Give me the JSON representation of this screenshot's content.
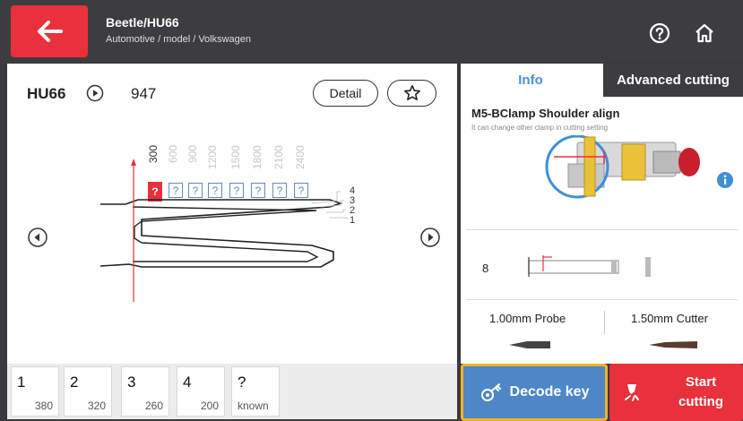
{
  "header": {
    "title": "Beetle/HU66",
    "breadcrumb": "Automotive / model / Volkswagen",
    "help_icon": "help-circle-icon",
    "home_icon": "home-icon",
    "accent": "#e8313b"
  },
  "key": {
    "code": "HU66",
    "number": "947",
    "detail_label": "Detail",
    "depths": [
      "300",
      "600",
      "900",
      "1200",
      "1500",
      "1800",
      "2100",
      "2400"
    ],
    "cut_boxes": [
      "?",
      "?",
      "?",
      "?",
      "?",
      "?",
      "?",
      "?"
    ],
    "tracks": [
      "4",
      "3",
      "2",
      "1"
    ]
  },
  "cuts": [
    {
      "num": "1",
      "value": "380"
    },
    {
      "num": "2",
      "value": "320"
    },
    {
      "num": "3",
      "value": "260"
    },
    {
      "num": "4",
      "value": "200"
    },
    {
      "num": "?",
      "value": "known"
    }
  ],
  "right": {
    "tab_info": "Info",
    "tab_advanced": "Advanced cutting",
    "clamp_title": "M5-BClamp Shoulder align",
    "clamp_sub": "It can change other clamp in cutting setting",
    "probe_number": "8",
    "probe": "1.00mm Probe",
    "cutter": "1.50mm Cutter"
  },
  "actions": {
    "decode_label": "Decode key",
    "start_label": "Start cutting",
    "decode_color": "#4e86c8",
    "highlight_color": "#f0b429"
  }
}
